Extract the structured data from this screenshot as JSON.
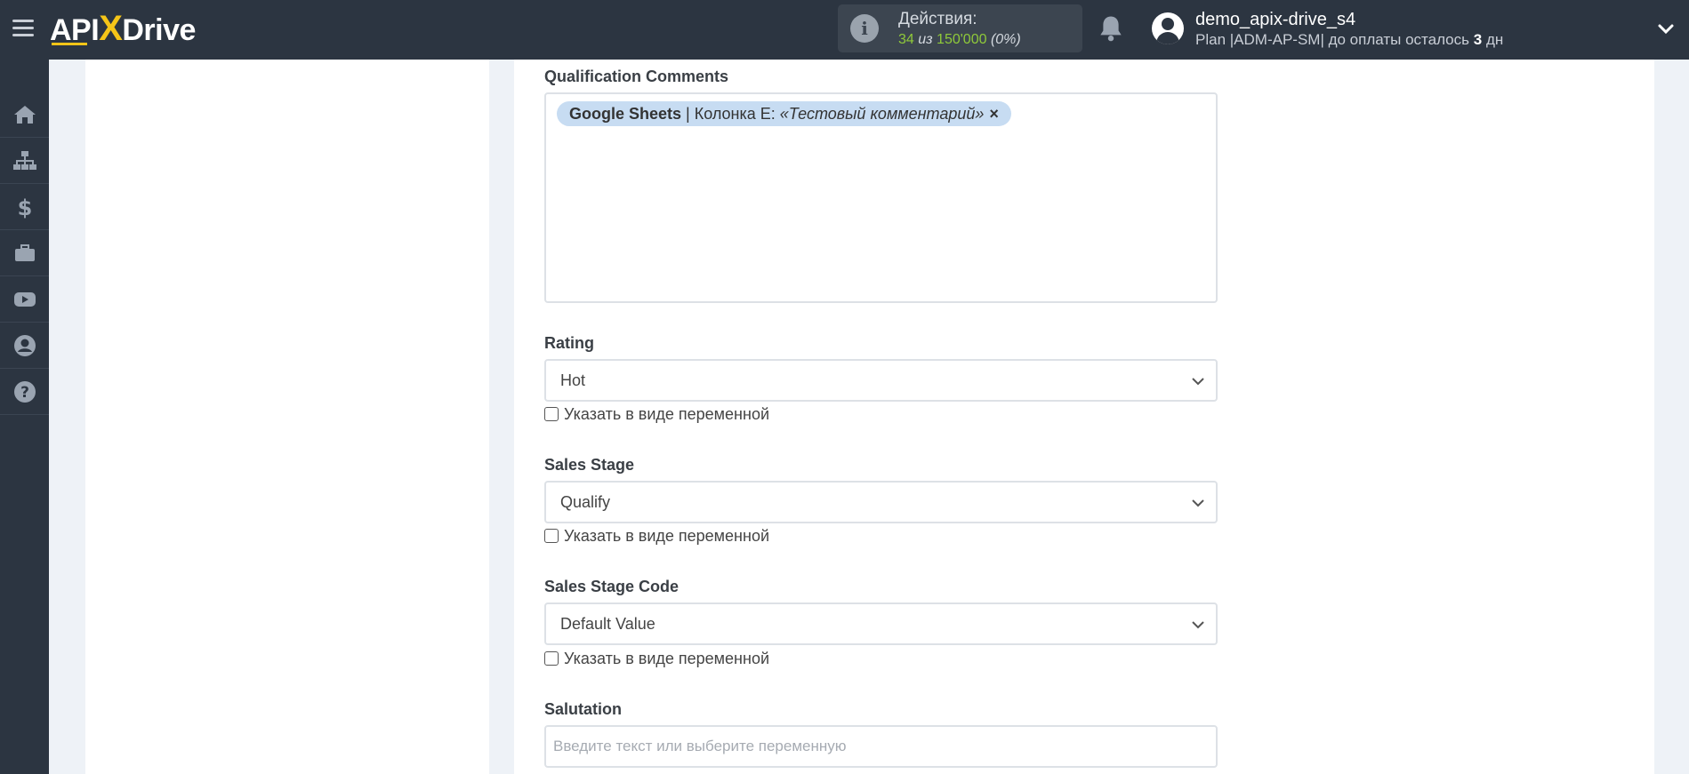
{
  "header": {
    "logo": {
      "part1": "API",
      "x": "X",
      "part2": "Drive"
    },
    "actions": {
      "label": "Действия:",
      "used": "34",
      "of_word": "из",
      "total": "150'000",
      "percent": "(0%)"
    },
    "user": {
      "name": "demo_apix-drive_s4",
      "plan_prefix": "Plan |ADM-AP-SM| до оплаты осталось",
      "days": "3",
      "days_unit": "дн"
    }
  },
  "sidebar": {
    "items": [
      {
        "icon": "home-icon"
      },
      {
        "icon": "sitemap-icon"
      },
      {
        "icon": "dollar-icon"
      },
      {
        "icon": "briefcase-icon"
      },
      {
        "icon": "youtube-icon"
      },
      {
        "icon": "user-circle-icon"
      },
      {
        "icon": "help-icon"
      }
    ]
  },
  "form": {
    "qualification_comments": {
      "label": "Qualification Comments",
      "chip": {
        "source": "Google Sheets",
        "separator": "|",
        "column": "Колонка E:",
        "value": "«Тестовый комментарий»"
      }
    },
    "rating": {
      "label": "Rating",
      "value": "Hot",
      "checkbox_label": "Указать в виде переменной"
    },
    "sales_stage": {
      "label": "Sales Stage",
      "value": "Qualify",
      "checkbox_label": "Указать в виде переменной"
    },
    "sales_stage_code": {
      "label": "Sales Stage Code",
      "value": "Default Value",
      "checkbox_label": "Указать в виде переменной"
    },
    "salutation": {
      "label": "Salutation",
      "placeholder": "Введите текст или выберите переменную"
    }
  },
  "colors": {
    "topbar": "#2c3541",
    "accent_yellow": "#f5c518",
    "actions_green": "#8fc93a",
    "chip_bg": "#c7dcf2"
  }
}
